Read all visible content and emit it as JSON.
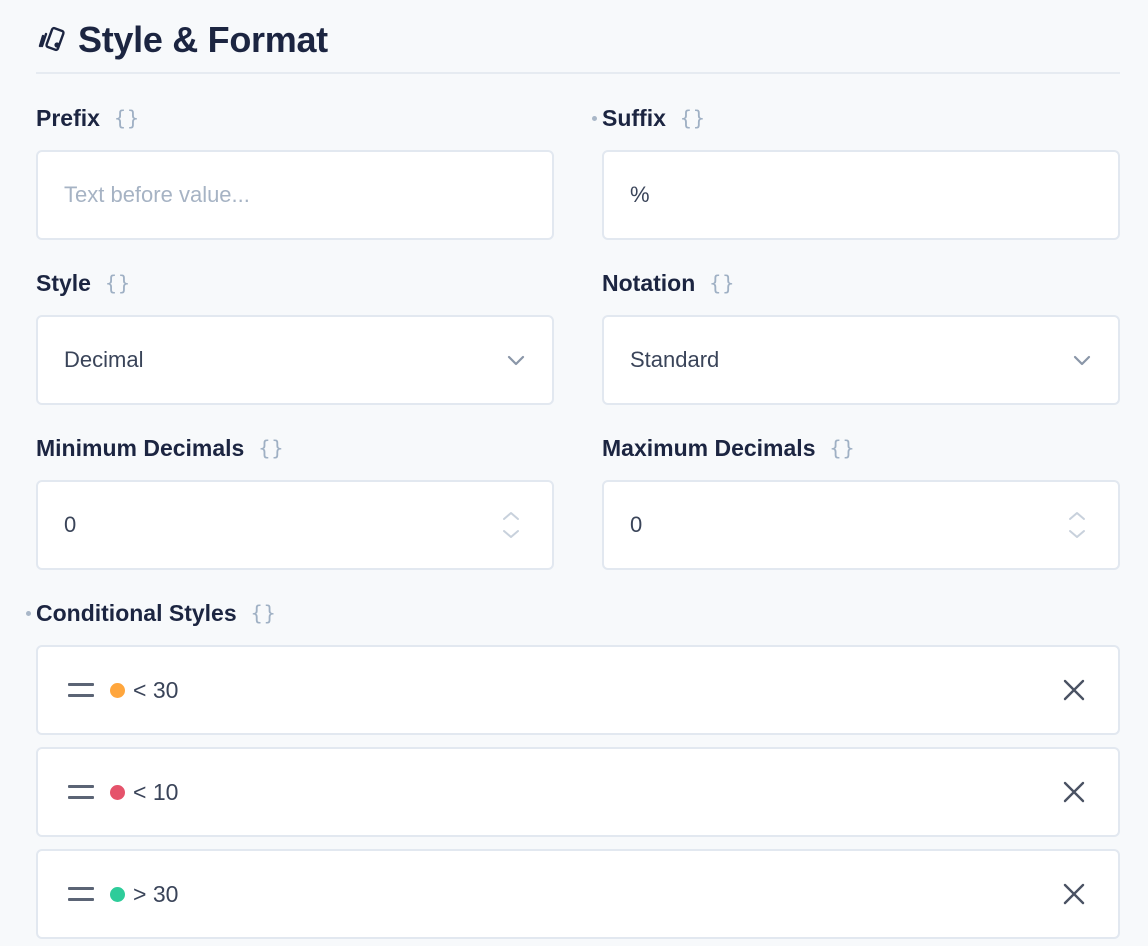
{
  "section": {
    "title": "Style & Format",
    "icon": "paint-brush-icon"
  },
  "fields": {
    "prefix": {
      "label": "Prefix",
      "braces": "{}",
      "value": "",
      "placeholder": "Text before value..."
    },
    "suffix": {
      "label": "Suffix",
      "braces": "{}",
      "value": "%",
      "placeholder": ""
    },
    "style": {
      "label": "Style",
      "braces": "{}",
      "selected": "Decimal",
      "icon": "chevron-down-icon"
    },
    "notation": {
      "label": "Notation",
      "braces": "{}",
      "selected": "Standard",
      "icon": "chevron-down-icon"
    },
    "min_decimals": {
      "label": "Minimum Decimals",
      "braces": "{}",
      "value": "0"
    },
    "max_decimals": {
      "label": "Maximum Decimals",
      "braces": "{}",
      "value": "0"
    }
  },
  "conditional_styles": {
    "label": "Conditional Styles",
    "braces": "{}",
    "items": [
      {
        "condition": "< 30",
        "color": "#ffa63d"
      },
      {
        "condition": "< 10",
        "color": "#e5536b"
      },
      {
        "condition": "> 30",
        "color": "#2ecc9a"
      }
    ]
  },
  "colors": {
    "label_text": "#1c2541",
    "border": "#e2e8f0",
    "braces": "#9fb0c4",
    "background": "#f7f9fb"
  }
}
